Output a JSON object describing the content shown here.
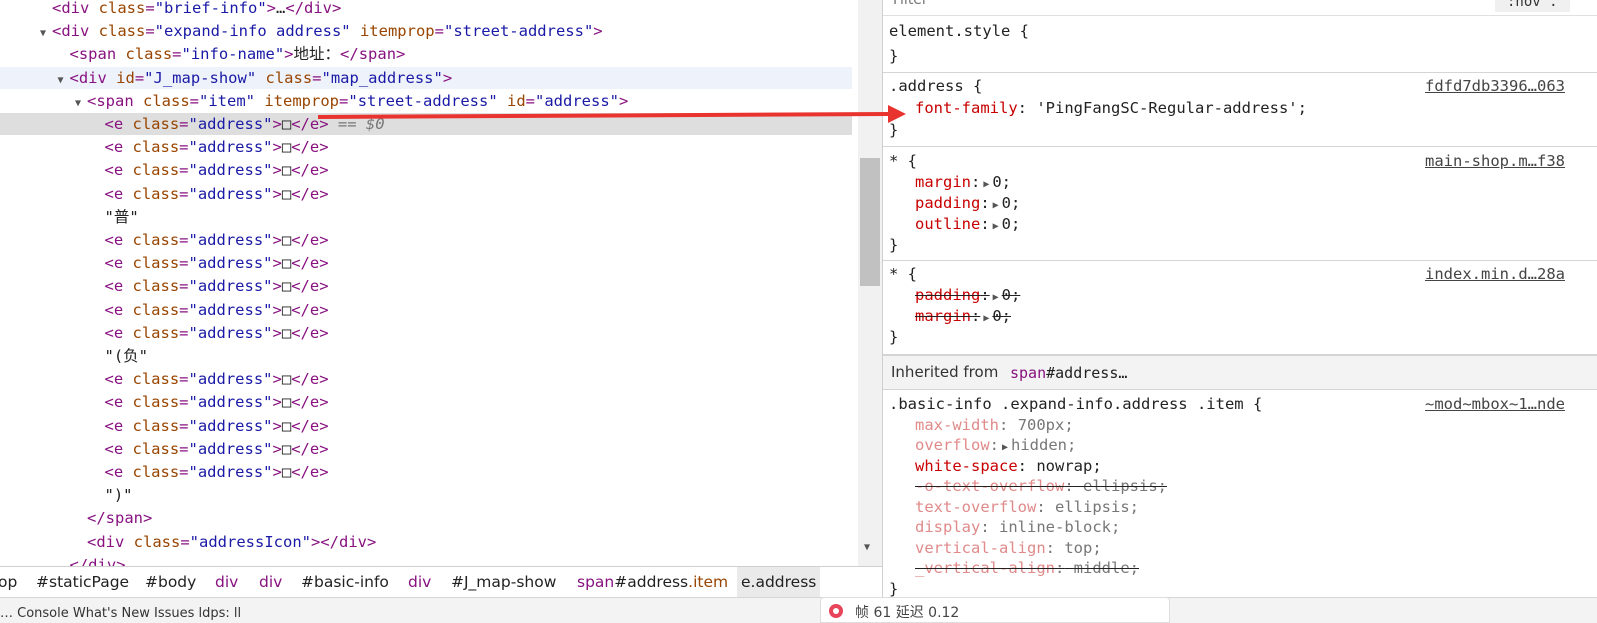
{
  "elements": {
    "lines": [
      {
        "indent": 2,
        "tri": "",
        "parts": [
          [
            "tag",
            "<"
          ],
          [
            "tag",
            "div"
          ],
          [
            "attr",
            " class"
          ],
          [
            "tag",
            "="
          ],
          [
            "val",
            "\"brief-info\""
          ],
          [
            "tag",
            ">"
          ],
          [
            "txt",
            "…"
          ],
          [
            "tag",
            "</div>"
          ]
        ]
      },
      {
        "indent": 2,
        "tri": "▼",
        "parts": [
          [
            "tag",
            "<div"
          ],
          [
            "attr",
            " class"
          ],
          [
            "tag",
            "="
          ],
          [
            "val",
            "\"expand-info address\""
          ],
          [
            "attr",
            " itemprop"
          ],
          [
            "tag",
            "="
          ],
          [
            "val",
            "\"street-address\""
          ],
          [
            "tag",
            ">"
          ]
        ]
      },
      {
        "indent": 3,
        "tri": "",
        "parts": [
          [
            "tag",
            "<span"
          ],
          [
            "attr",
            " class"
          ],
          [
            "tag",
            "="
          ],
          [
            "val",
            "\"info-name\""
          ],
          [
            "tag",
            ">"
          ],
          [
            "txt",
            "地址："
          ],
          [
            "tag",
            "</span>"
          ]
        ]
      },
      {
        "indent": 3,
        "tri": "▼",
        "hover": true,
        "parts": [
          [
            "tag",
            "<div"
          ],
          [
            "attr",
            " id"
          ],
          [
            "tag",
            "="
          ],
          [
            "val",
            "\"J_map-show\""
          ],
          [
            "attr",
            " class"
          ],
          [
            "tag",
            "="
          ],
          [
            "val",
            "\"map_address\""
          ],
          [
            "tag",
            ">"
          ]
        ]
      },
      {
        "indent": 4,
        "tri": "▼",
        "parts": [
          [
            "tag",
            "<span"
          ],
          [
            "attr",
            " class"
          ],
          [
            "tag",
            "="
          ],
          [
            "val",
            "\"item\""
          ],
          [
            "attr",
            " itemprop"
          ],
          [
            "tag",
            "="
          ],
          [
            "val",
            "\"street-address\""
          ],
          [
            "attr",
            " id"
          ],
          [
            "tag",
            "="
          ],
          [
            "val",
            "\"address\""
          ],
          [
            "tag",
            ">"
          ]
        ]
      },
      {
        "indent": 5,
        "tri": "",
        "selected": true,
        "parts": [
          [
            "tag",
            "<e"
          ],
          [
            "attr",
            " class"
          ],
          [
            "tag",
            "="
          ],
          [
            "val",
            "\"address\""
          ],
          [
            "tag",
            ">"
          ],
          [
            "txt",
            "□"
          ],
          [
            "tag",
            "</e>"
          ],
          [
            "eq",
            " == $0"
          ]
        ]
      },
      {
        "indent": 5,
        "tri": "",
        "parts": [
          [
            "tag",
            "<e"
          ],
          [
            "attr",
            " class"
          ],
          [
            "tag",
            "="
          ],
          [
            "val",
            "\"address\""
          ],
          [
            "tag",
            ">"
          ],
          [
            "txt",
            "□"
          ],
          [
            "tag",
            "</e>"
          ]
        ]
      },
      {
        "indent": 5,
        "tri": "",
        "parts": [
          [
            "tag",
            "<e"
          ],
          [
            "attr",
            " class"
          ],
          [
            "tag",
            "="
          ],
          [
            "val",
            "\"address\""
          ],
          [
            "tag",
            ">"
          ],
          [
            "txt",
            "□"
          ],
          [
            "tag",
            "</e>"
          ]
        ]
      },
      {
        "indent": 5,
        "tri": "",
        "parts": [
          [
            "tag",
            "<e"
          ],
          [
            "attr",
            " class"
          ],
          [
            "tag",
            "="
          ],
          [
            "val",
            "\"address\""
          ],
          [
            "tag",
            ">"
          ],
          [
            "txt",
            "□"
          ],
          [
            "tag",
            "</e>"
          ]
        ]
      },
      {
        "indent": 5,
        "tri": "",
        "parts": [
          [
            "txt",
            "\"普\""
          ]
        ]
      },
      {
        "indent": 5,
        "tri": "",
        "parts": [
          [
            "tag",
            "<e"
          ],
          [
            "attr",
            " class"
          ],
          [
            "tag",
            "="
          ],
          [
            "val",
            "\"address\""
          ],
          [
            "tag",
            ">"
          ],
          [
            "txt",
            "□"
          ],
          [
            "tag",
            "</e>"
          ]
        ]
      },
      {
        "indent": 5,
        "tri": "",
        "parts": [
          [
            "tag",
            "<e"
          ],
          [
            "attr",
            " class"
          ],
          [
            "tag",
            "="
          ],
          [
            "val",
            "\"address\""
          ],
          [
            "tag",
            ">"
          ],
          [
            "txt",
            "□"
          ],
          [
            "tag",
            "</e>"
          ]
        ]
      },
      {
        "indent": 5,
        "tri": "",
        "parts": [
          [
            "tag",
            "<e"
          ],
          [
            "attr",
            " class"
          ],
          [
            "tag",
            "="
          ],
          [
            "val",
            "\"address\""
          ],
          [
            "tag",
            ">"
          ],
          [
            "txt",
            "□"
          ],
          [
            "tag",
            "</e>"
          ]
        ]
      },
      {
        "indent": 5,
        "tri": "",
        "parts": [
          [
            "tag",
            "<e"
          ],
          [
            "attr",
            " class"
          ],
          [
            "tag",
            "="
          ],
          [
            "val",
            "\"address\""
          ],
          [
            "tag",
            ">"
          ],
          [
            "txt",
            "□"
          ],
          [
            "tag",
            "</e>"
          ]
        ]
      },
      {
        "indent": 5,
        "tri": "",
        "parts": [
          [
            "tag",
            "<e"
          ],
          [
            "attr",
            " class"
          ],
          [
            "tag",
            "="
          ],
          [
            "val",
            "\"address\""
          ],
          [
            "tag",
            ">"
          ],
          [
            "txt",
            "□"
          ],
          [
            "tag",
            "</e>"
          ]
        ]
      },
      {
        "indent": 5,
        "tri": "",
        "parts": [
          [
            "txt",
            "\"(负\""
          ]
        ]
      },
      {
        "indent": 5,
        "tri": "",
        "parts": [
          [
            "tag",
            "<e"
          ],
          [
            "attr",
            " class"
          ],
          [
            "tag",
            "="
          ],
          [
            "val",
            "\"address\""
          ],
          [
            "tag",
            ">"
          ],
          [
            "txt",
            "□"
          ],
          [
            "tag",
            "</e>"
          ]
        ]
      },
      {
        "indent": 5,
        "tri": "",
        "parts": [
          [
            "tag",
            "<e"
          ],
          [
            "attr",
            " class"
          ],
          [
            "tag",
            "="
          ],
          [
            "val",
            "\"address\""
          ],
          [
            "tag",
            ">"
          ],
          [
            "txt",
            "□"
          ],
          [
            "tag",
            "</e>"
          ]
        ]
      },
      {
        "indent": 5,
        "tri": "",
        "parts": [
          [
            "tag",
            "<e"
          ],
          [
            "attr",
            " class"
          ],
          [
            "tag",
            "="
          ],
          [
            "val",
            "\"address\""
          ],
          [
            "tag",
            ">"
          ],
          [
            "txt",
            "□"
          ],
          [
            "tag",
            "</e>"
          ]
        ]
      },
      {
        "indent": 5,
        "tri": "",
        "parts": [
          [
            "tag",
            "<e"
          ],
          [
            "attr",
            " class"
          ],
          [
            "tag",
            "="
          ],
          [
            "val",
            "\"address\""
          ],
          [
            "tag",
            ">"
          ],
          [
            "txt",
            "□"
          ],
          [
            "tag",
            "</e>"
          ]
        ]
      },
      {
        "indent": 5,
        "tri": "",
        "parts": [
          [
            "tag",
            "<e"
          ],
          [
            "attr",
            " class"
          ],
          [
            "tag",
            "="
          ],
          [
            "val",
            "\"address\""
          ],
          [
            "tag",
            ">"
          ],
          [
            "txt",
            "□"
          ],
          [
            "tag",
            "</e>"
          ]
        ]
      },
      {
        "indent": 5,
        "tri": "",
        "parts": [
          [
            "txt",
            "\")\""
          ]
        ]
      },
      {
        "indent": 4,
        "tri": "",
        "parts": [
          [
            "tag",
            "</span>"
          ]
        ]
      },
      {
        "indent": 4,
        "tri": "",
        "parts": [
          [
            "tag",
            "<div"
          ],
          [
            "attr",
            " class"
          ],
          [
            "tag",
            "="
          ],
          [
            "val",
            "\"addressIcon\""
          ],
          [
            "tag",
            ">"
          ],
          [
            "tag",
            "</div>"
          ]
        ]
      },
      {
        "indent": 3,
        "tri": "",
        "parts": [
          [
            "tag",
            "</div>"
          ]
        ]
      }
    ]
  },
  "breadcrumb": [
    {
      "tag": "",
      "rest": "op",
      "kind": "id"
    },
    {
      "tag": "",
      "rest": "#staticPage",
      "kind": "id"
    },
    {
      "tag": "",
      "rest": "#body",
      "kind": "id"
    },
    {
      "tag": "div",
      "rest": "",
      "kind": "tag"
    },
    {
      "tag": "div",
      "rest": "",
      "kind": "tag"
    },
    {
      "tag": "",
      "rest": "#basic-info",
      "kind": "id"
    },
    {
      "tag": "div",
      "rest": "",
      "kind": "tag"
    },
    {
      "tag": "",
      "rest": "#J_map-show",
      "kind": "id"
    },
    {
      "tag": "span",
      "rest": "#address",
      "cls": ".item",
      "kind": "mixed"
    },
    {
      "tag": "",
      "rest": "e.address",
      "kind": "active"
    }
  ],
  "bottom_strip": {
    "text": "    …    Console      What's New      Issues   ldps: ll"
  },
  "fps_badge": {
    "text": "帧 61 延迟 0.12"
  },
  "styles": {
    "filter_placeholder": "Filter",
    "hov_label": ":hov .",
    "element_style": {
      "selector": "element.style {",
      "close": "}"
    },
    "rules": [
      {
        "selector": ".address {",
        "source": "fdfd7db3396…063",
        "props": [
          {
            "name": "font-family",
            "value": "'PingFangSC-Regular-address';",
            "state": "active"
          }
        ]
      },
      {
        "selector": "* {",
        "source": "main-shop.m…f38",
        "props": [
          {
            "name": "margin",
            "value": "0;",
            "state": "active",
            "expand": true
          },
          {
            "name": "padding",
            "value": "0;",
            "state": "active",
            "expand": true
          },
          {
            "name": "outline",
            "value": "0;",
            "state": "active",
            "expand": true
          }
        ]
      },
      {
        "selector": "* {",
        "source": "index.min.d…28a",
        "props": [
          {
            "name": "padding",
            "value": "0;",
            "state": "struck",
            "expand": true
          },
          {
            "name": "margin",
            "value": "0;",
            "state": "struck",
            "expand": true
          }
        ]
      }
    ],
    "inherited": {
      "label": "Inherited from",
      "tag": "span",
      "rest": "#address…"
    },
    "inherited_rule": {
      "selector": ".basic-info .expand-info.address .item {",
      "source": "~mod~mbox~1…nde",
      "props": [
        {
          "name": "max-width",
          "value": "700px;",
          "state": "dim"
        },
        {
          "name": "overflow",
          "value": "hidden;",
          "state": "dim",
          "expand": true
        },
        {
          "name": "white-space",
          "value": "nowrap;",
          "state": "active"
        },
        {
          "name": "-o-text-overflow",
          "value": "ellipsis;",
          "state": "struck-dim"
        },
        {
          "name": "text-overflow",
          "value": "ellipsis;",
          "state": "dim"
        },
        {
          "name": "display",
          "value": "inline-block;",
          "state": "dim"
        },
        {
          "name": "vertical-align",
          "value": "top;",
          "state": "dim"
        },
        {
          "name": "_vertical-align",
          "value": "middle;",
          "state": "struck-dim"
        }
      ]
    }
  },
  "annotation": {
    "arrow_color": "#e8332f"
  }
}
